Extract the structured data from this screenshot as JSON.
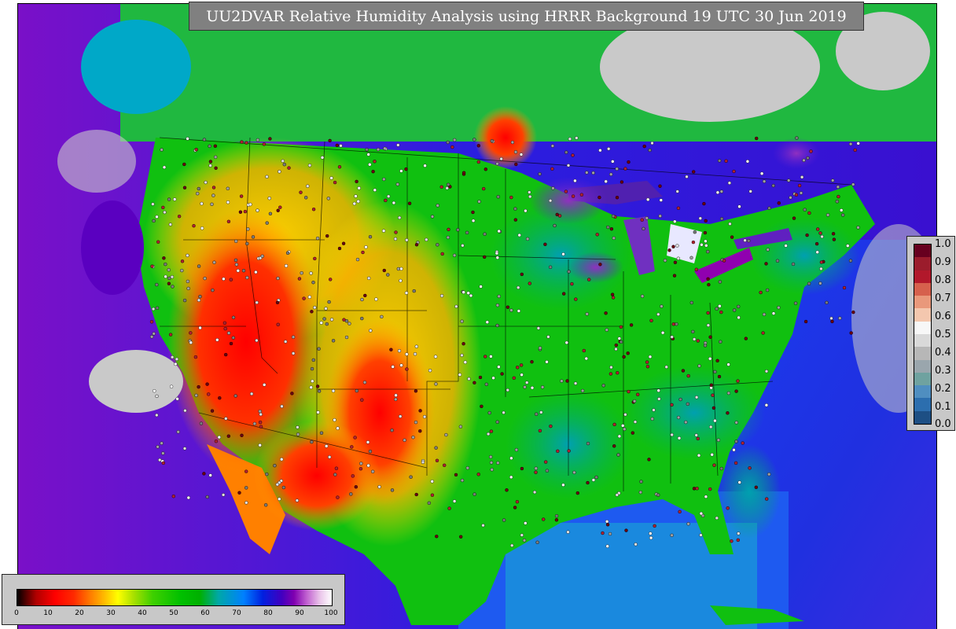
{
  "title": "UU2DVAR Relative Humidity Analysis using HRRR Background 19 UTC 30 Jun 2019",
  "colorbar_right": {
    "labels": [
      "1.0",
      "0.9",
      "0.8",
      "0.7",
      "0.6",
      "0.5",
      "0.4",
      "0.3",
      "0.2",
      "0.1",
      "0.0"
    ],
    "colors": [
      "#67001f",
      "#9b1c2c",
      "#b2182b",
      "#d6604d",
      "#e9987b",
      "#f4c7ae",
      "#f7f7f7",
      "#d9d9d9",
      "#b7b7b7",
      "#9aa6ad",
      "#6fa2a0",
      "#4f8ec0",
      "#2c6eae",
      "#1d4f84"
    ]
  },
  "colorbar_bottom": {
    "ticks": [
      "0",
      "10",
      "20",
      "30",
      "40",
      "50",
      "60",
      "70",
      "80",
      "90",
      "100"
    ]
  },
  "colors": {
    "ocean": "#1b22d8",
    "land_green": "#10c010",
    "dry_red": "#ff0000",
    "dry_orange": "#ff8c00",
    "gray_region": "#c9c9c9"
  }
}
